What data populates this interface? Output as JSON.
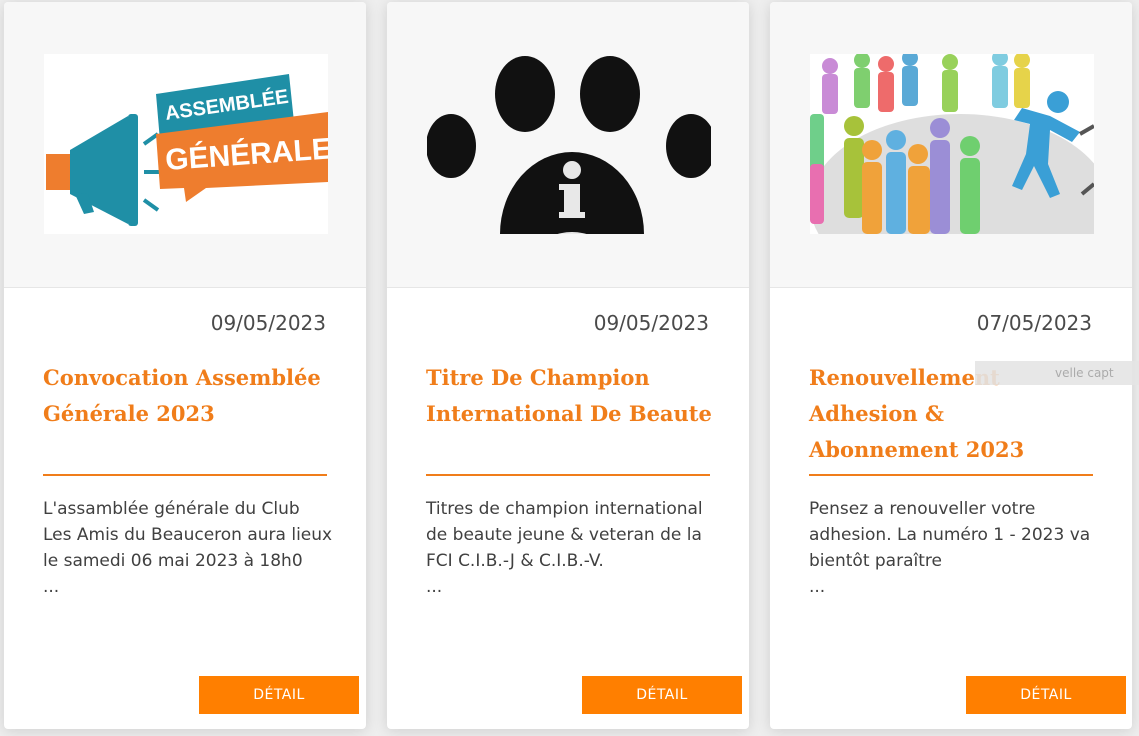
{
  "cards": [
    {
      "date": "09/05/2023",
      "title": "Convocation Assemblée Générale 2023",
      "excerpt": "L'assamblée générale du Club Les Amis du Beauceron aura lieux le samedi 06 mai 2023 à 18h0",
      "ellipsis": "...",
      "button": "DÉTAIL",
      "image": {
        "name": "assemblee-generale-image",
        "text_top": "ASSEMBLÉE",
        "text_bottom": "GÉNÉRALE",
        "colors": {
          "teal": "#1f8fa6",
          "orange": "#ee7d2e"
        }
      }
    },
    {
      "date": "09/05/2023",
      "title": "Titre De Champion International De Beaute",
      "excerpt": "Titres de champion international de beaute jeune & veteran de la FCI C.I.B.-J & C.I.B.-V.",
      "ellipsis": "...",
      "button": "DÉTAIL",
      "image": {
        "name": "paw-info-image",
        "glyph": "i"
      }
    },
    {
      "date": "07/05/2023",
      "title": "Renouvellement Adhesion & Abonnement 2023",
      "excerpt": "Pensez a renouveller votre adhesion. La numéro 1 - 2023 va bientôt paraître",
      "ellipsis": "...",
      "button": "DÉTAIL",
      "image": {
        "name": "people-group-image"
      }
    }
  ],
  "overlay": {
    "text": "velle capt"
  },
  "colors": {
    "accent": "#f07d1a",
    "button": "#ff7f00"
  }
}
